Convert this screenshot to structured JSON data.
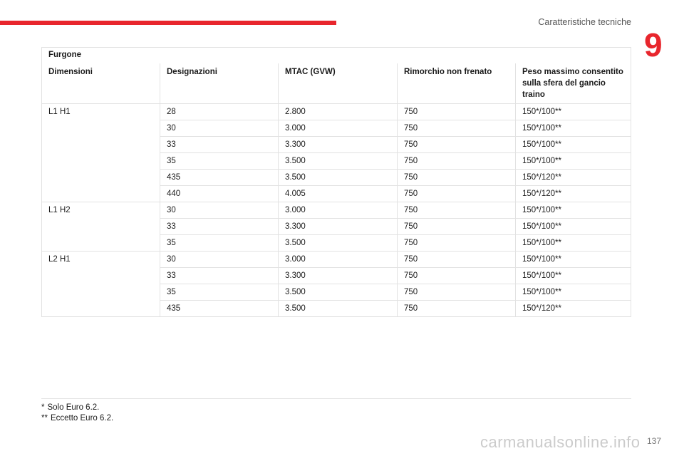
{
  "header": {
    "section_title": "Caratteristiche tecniche",
    "chapter_number": "9",
    "accent_color": "#e8262d"
  },
  "table": {
    "title": "Furgone",
    "columns": [
      "Dimensioni",
      "Designazioni",
      "MTAC (GVW)",
      "Rimorchio non frenato",
      "Peso massimo consentito sulla sfera del gancio traino"
    ],
    "groups": [
      {
        "dimension": "L1 H1",
        "rows": [
          [
            "28",
            "2.800",
            "750",
            "150*/100**"
          ],
          [
            "30",
            "3.000",
            "750",
            "150*/100**"
          ],
          [
            "33",
            "3.300",
            "750",
            "150*/100**"
          ],
          [
            "35",
            "3.500",
            "750",
            "150*/100**"
          ],
          [
            "435",
            "3.500",
            "750",
            "150*/120**"
          ],
          [
            "440",
            "4.005",
            "750",
            "150*/120**"
          ]
        ]
      },
      {
        "dimension": "L1 H2",
        "rows": [
          [
            "30",
            "3.000",
            "750",
            "150*/100**"
          ],
          [
            "33",
            "3.300",
            "750",
            "150*/100**"
          ],
          [
            "35",
            "3.500",
            "750",
            "150*/100**"
          ]
        ]
      },
      {
        "dimension": "L2 H1",
        "rows": [
          [
            "30",
            "3.000",
            "750",
            "150*/100**"
          ],
          [
            "33",
            "3.300",
            "750",
            "150*/100**"
          ],
          [
            "35",
            "3.500",
            "750",
            "150*/100**"
          ],
          [
            "435",
            "3.500",
            "750",
            "150*/120**"
          ]
        ]
      }
    ]
  },
  "footnotes": [
    {
      "mark": "*",
      "text": "Solo Euro 6.2."
    },
    {
      "mark": "**",
      "text": "Eccetto Euro 6.2."
    }
  ],
  "page_number": "137",
  "watermark": "carmanualsonline.info"
}
